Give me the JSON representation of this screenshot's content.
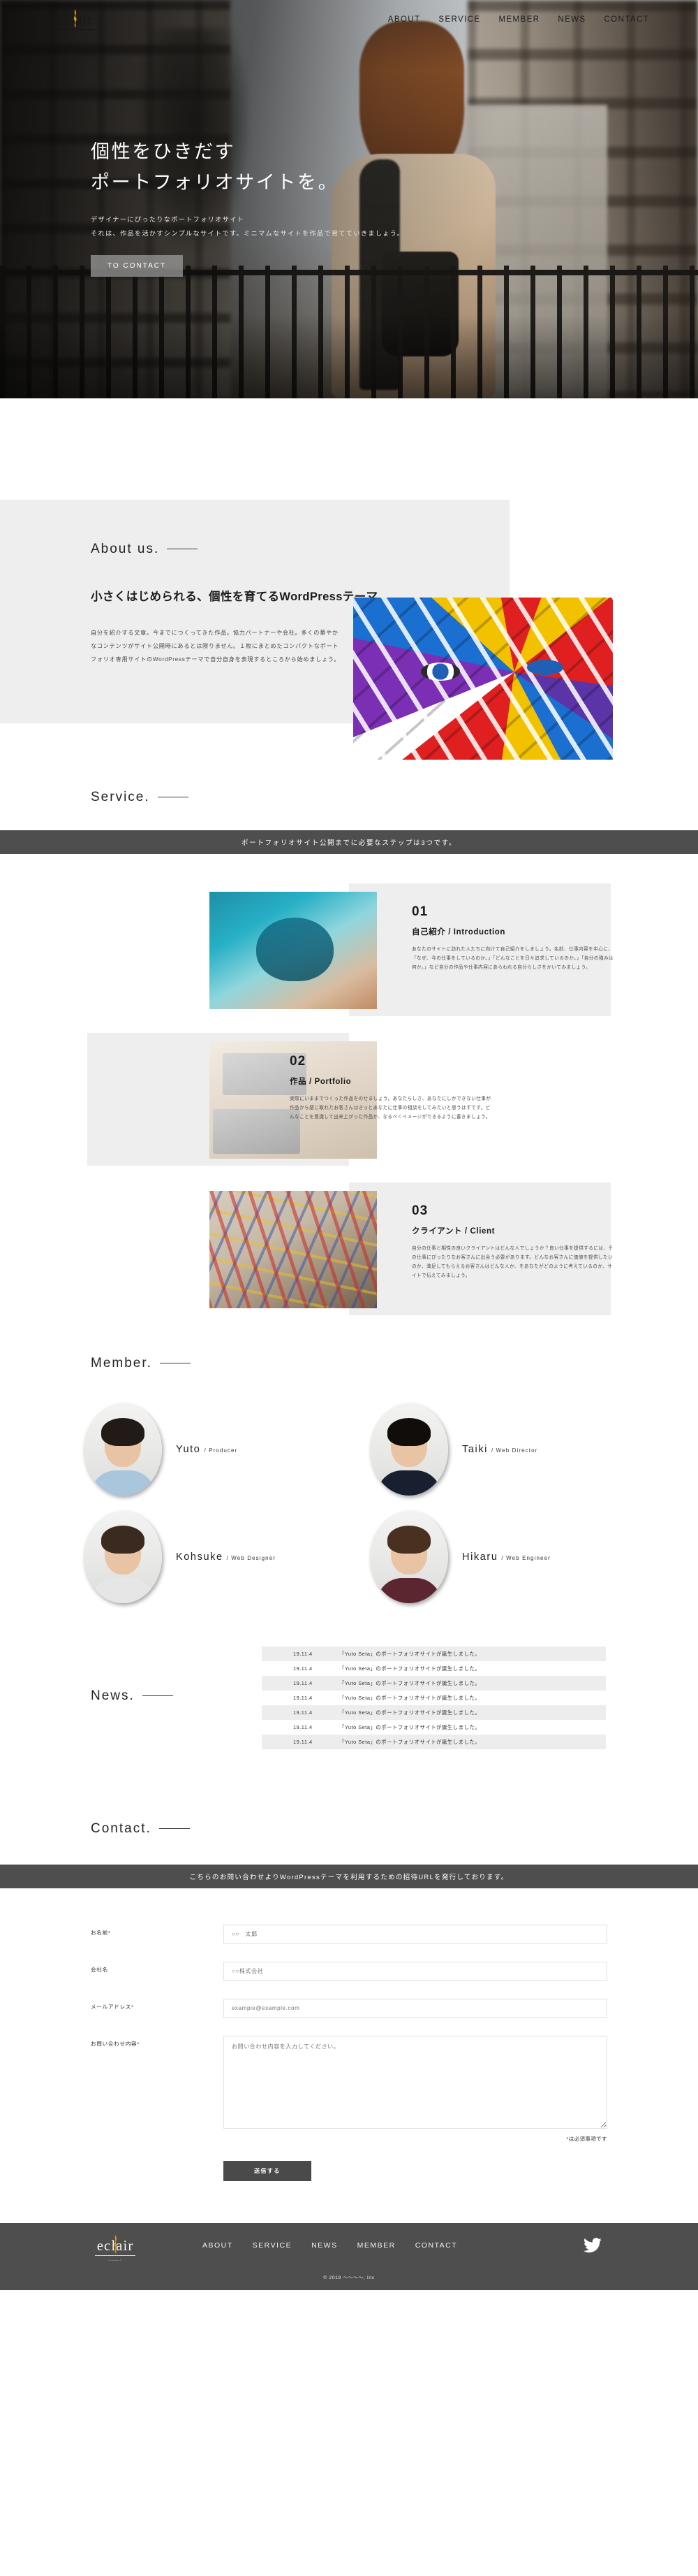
{
  "brand": {
    "logo_text": "eclair",
    "logo_bolt": "⚡",
    "logo_sub": "• ——— •",
    "accent_gold": "#d79b17",
    "dark_band": "#4e4e4e",
    "panel_grey": "#eeeeee"
  },
  "header": {
    "nav": [
      {
        "label": "ABOUT"
      },
      {
        "label": "SERVICE"
      },
      {
        "label": "MEMBER"
      },
      {
        "label": "NEWS"
      },
      {
        "label": "CONTACT"
      }
    ]
  },
  "hero": {
    "line1": "個性をひきだす",
    "line2": "ポートフォリオサイトを。",
    "lead1": "デザイナーにぴったりなポートフォリオサイト",
    "lead2": "それは、作品を活かすシンプルなサイトです。ミニマムなサイトを作品で育てていきましょう。",
    "cta": "TO CONTACT"
  },
  "about": {
    "heading": "About us.",
    "title": "小さくはじめられる、個性を育てるWordPressテーマ",
    "body": "自分を紹介する文章。今までにつくってきた作品。協力パートナーや会社。多くの華やかなコンテンツがサイト公開時にあるとは限りません。１枚にまとめたコンパクトなポートフォリオ専用サイトのWordPressテーマで自分自身を表現するところから始めましょう。",
    "image_alt": "face-paint-portrait"
  },
  "service": {
    "heading": "Service.",
    "banner": "ポートフォリオサイト公開までに必要なステップは3つです。",
    "steps": [
      {
        "num": "01",
        "title": "自己紹介 / Introduction",
        "text": "あなたのサイトに訪れた人たちに向けて自己紹介をしましょう。名前、仕事内容を中心に、「なぜ、今の仕事をしているのか。」「どんなことを日々追求しているのか。」「自分の強みは何か。」など自分の作品や仕事内容にあらわれる自分らしさをかいてみましょう。",
        "image_alt": "blue-hair-sunglasses-portrait"
      },
      {
        "num": "02",
        "title": "作品 / Portfolio",
        "text": "実際にいままでつくった作品をのせましょう。あなたらしさ、あなたにしかできない仕事が作品から感じ取れたお客さんはきっとあなたに仕事の相談をしてみたいと思うはずです。どんなことを意識して出来上がった作品か、なるべくイメージができるように書きましょう。",
        "image_alt": "desk-laptop-flatlay"
      },
      {
        "num": "03",
        "title": "クライアント / Client",
        "text": "自分の仕事と相性の良いクライアントはどんな人でしょうか？良い仕事を提供するには、その仕事にぴったりなお客さんに出会う必要があります。どんなお客さんに価値を提供したいのか、満足してもらえるお客さんはどんな人か、をあなたがどのように考えているのか、サイトで伝えてみましょう。",
        "image_alt": "art-supplies-brushes"
      }
    ]
  },
  "member": {
    "heading": "Member.",
    "people": [
      {
        "name": "Yuto",
        "role": "/ Producer"
      },
      {
        "name": "Taiki",
        "role": "/ Web Director"
      },
      {
        "name": "Kohsuke",
        "role": "/ Web Designer"
      },
      {
        "name": "Hikaru",
        "role": "/ Web Engineer"
      }
    ]
  },
  "news": {
    "heading": "News.",
    "items": [
      {
        "date": "19.11.4",
        "title": "「Yuto Seta」のポートフォリオサイトが誕生しました。"
      },
      {
        "date": "19.11.4",
        "title": "「Yuto Seta」のポートフォリオサイトが誕生しました。"
      },
      {
        "date": "19.11.4",
        "title": "「Yuto Seta」のポートフォリオサイトが誕生しました。"
      },
      {
        "date": "19.11.4",
        "title": "「Yuto Seta」のポートフォリオサイトが誕生しました。"
      },
      {
        "date": "19.11.4",
        "title": "「Yuto Seta」のポートフォリオサイトが誕生しました。"
      },
      {
        "date": "19.11.4",
        "title": "「Yuto Seta」のポートフォリオサイトが誕生しました。"
      },
      {
        "date": "19.11.4",
        "title": "「Yuto Seta」のポートフォリオサイトが誕生しました。"
      }
    ]
  },
  "contact": {
    "heading": "Contact.",
    "banner": "こちらのお問い合わせよりWordPressテーマを利用するための招待URLを発行しております。",
    "fields": {
      "name_label": "お名前*",
      "name_placeholder": "○○　太郎",
      "company_label": "会社名",
      "company_placeholder": "○○株式会社",
      "email_label": "メールアドレス*",
      "email_placeholder": "example@example.com",
      "message_label": "お問い合わせ内容*",
      "message_placeholder": "お問い合わせ内容を入力してください。"
    },
    "required_note": "*は必須事項です",
    "submit_label": "送信する"
  },
  "footer": {
    "nav": [
      {
        "label": "ABOUT"
      },
      {
        "label": "SERVICE"
      },
      {
        "label": "NEWS"
      },
      {
        "label": "MEMBER"
      },
      {
        "label": "CONTACT"
      }
    ],
    "copyright": "© 2019 ～～～～, Inc",
    "social": "twitter-icon"
  }
}
